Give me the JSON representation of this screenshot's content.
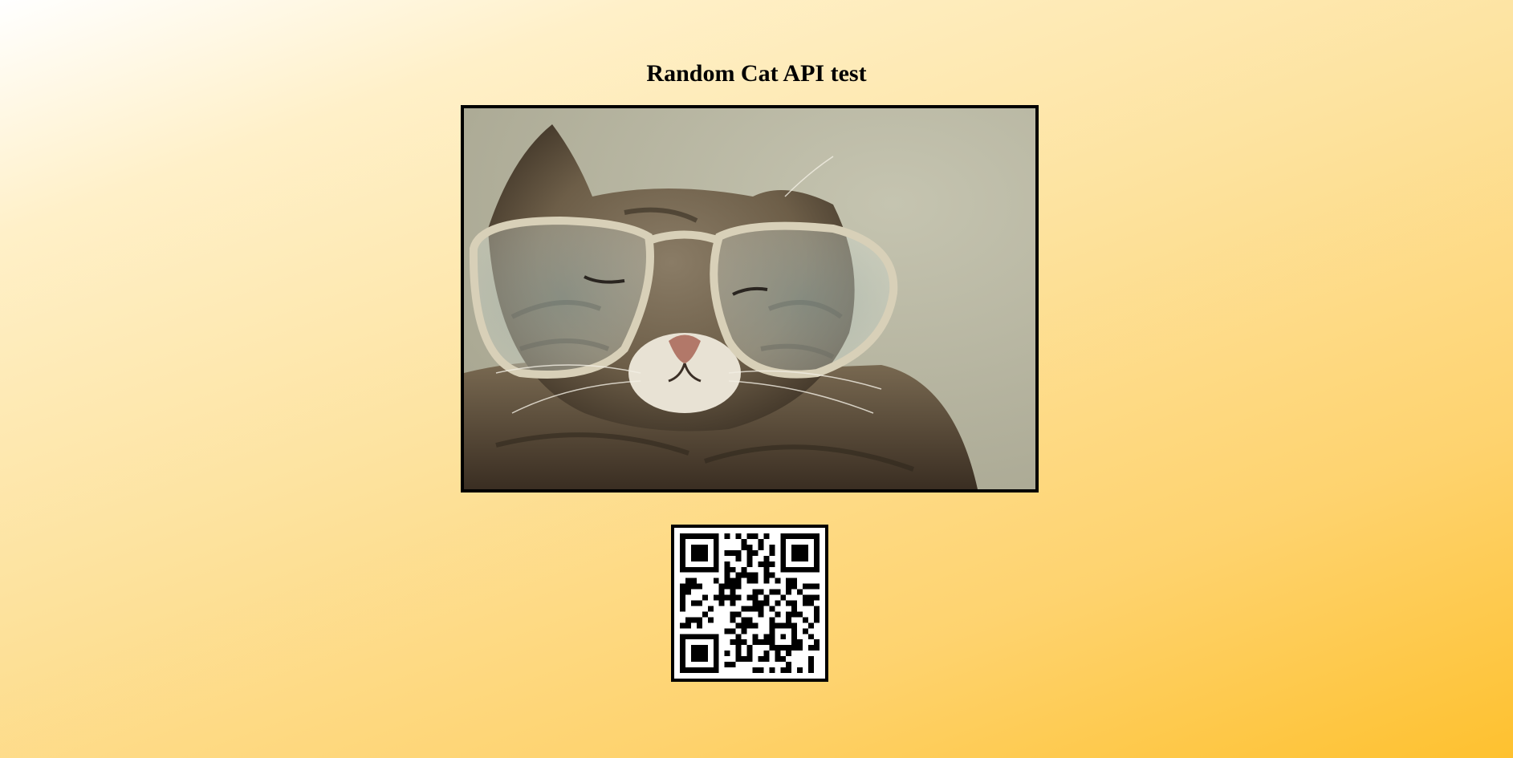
{
  "page": {
    "title": "Random Cat API test"
  },
  "image": {
    "subject": "cat-photo",
    "icon": "cat-image"
  },
  "qr": {
    "icon": "qr-code-icon"
  },
  "colors": {
    "background_start": "#ffffff",
    "background_end": "#fec12f",
    "frame_border": "#000000"
  }
}
